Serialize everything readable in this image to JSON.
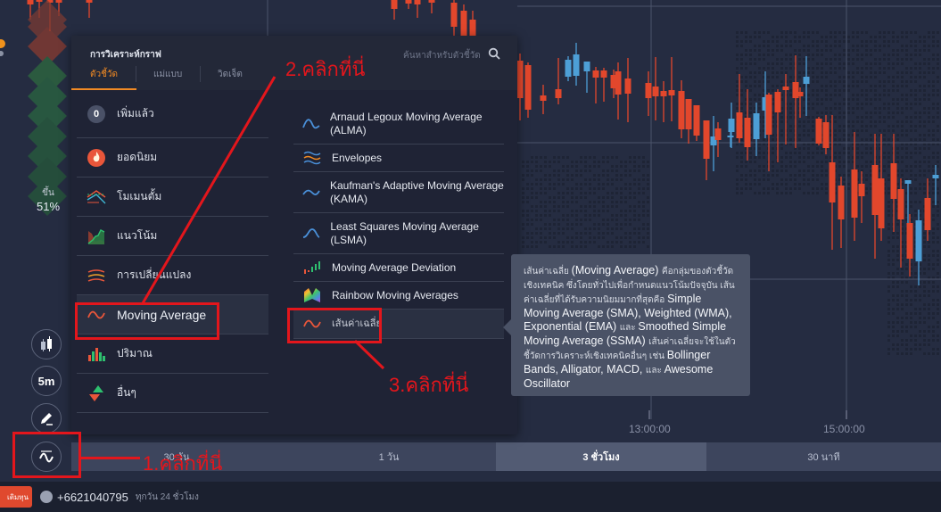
{
  "left_toolbar": {
    "sentiment_label": "ขึ้น",
    "sentiment_value": "51%",
    "chart_type_icon": "candlestick-icon",
    "timeframe_label": "5m",
    "draw_icon": "pencil-icon",
    "indicators_icon": "indicator-wave-icon"
  },
  "panel": {
    "title": "การวิเคราะห์กราฟ",
    "tabs": [
      {
        "label": "ตัวชี้วัด",
        "active": true
      },
      {
        "label": "แม่แบบ",
        "active": false
      },
      {
        "label": "วิดเจ็ต",
        "active": false
      }
    ],
    "search_placeholder": "ค้นหาสำหรับตัวชี้วัด",
    "categories": [
      {
        "label": "เพิ่มแล้ว",
        "badge": "0",
        "icon": "added-count-badge"
      },
      {
        "label": "ยอดนิยม",
        "icon": "fire-icon"
      },
      {
        "label": "โมเมนตั้ม",
        "icon": "momentum-icon"
      },
      {
        "label": "แนวโน้ม",
        "icon": "trend-icon"
      },
      {
        "label": "การเปลี่ยนแปลง",
        "icon": "volatility-icon"
      },
      {
        "label": "Moving Average",
        "icon": "moving-average-icon",
        "active": true
      },
      {
        "label": "ปริมาณ",
        "icon": "volume-icon"
      },
      {
        "label": "อื่นๆ",
        "icon": "other-arrows-icon"
      }
    ],
    "indicators": [
      {
        "label": "Arnaud Legoux Moving Average (ALMA)",
        "icon": "alma-icon"
      },
      {
        "label": "Envelopes",
        "icon": "envelopes-icon"
      },
      {
        "label": "Kaufman's Adaptive Moving Average (KAMA)",
        "icon": "kama-icon"
      },
      {
        "label": "Least Squares Moving Average (LSMA)",
        "icon": "lsma-icon"
      },
      {
        "label": "Moving Average Deviation",
        "icon": "ma-deviation-icon"
      },
      {
        "label": "Rainbow Moving Averages",
        "icon": "rainbow-icon"
      },
      {
        "label": "เส้นค่าเฉลี่ย",
        "icon": "moving-average-icon",
        "active": true
      }
    ]
  },
  "tooltip": {
    "parts": [
      {
        "t": "th",
        "v": "เส้นค่าเฉลี่ย "
      },
      {
        "t": "en",
        "v": "(Moving Average) "
      },
      {
        "t": "th",
        "v": "คือกลุ่มของตัวชี้วัดเชิงเทคนิค ซึ่งโดยทั่วไปเพื่อกำหนดแนวโน้มปัจจุบัน เส้นค่าเฉลี่ยที่ได้รับความนิยมมากที่สุดคือ "
      },
      {
        "t": "en",
        "v": "Simple Moving Average (SMA), Weighted (WMA), Exponential (EMA) "
      },
      {
        "t": "th",
        "v": "และ "
      },
      {
        "t": "en",
        "v": "Smoothed Simple Moving Average (SSMA) "
      },
      {
        "t": "th",
        "v": "เส้นค่าเฉลี่ยจะใช้ในตัวชี้วัดการวิเคราะห์เชิงเทคนิคอื่นๆ เช่น "
      },
      {
        "t": "en",
        "v": "Bollinger Bands, Alligator, MACD, "
      },
      {
        "t": "th",
        "v": "และ "
      },
      {
        "t": "en",
        "v": "Awesome Oscillator"
      }
    ]
  },
  "chart": {
    "time_labels": [
      "13:00:00",
      "15:00:00"
    ],
    "up_color": "#4d9fd6",
    "down_color": "#e2472c"
  },
  "range_bar": {
    "items": [
      {
        "label": "30 วัน",
        "active": false
      },
      {
        "label": "1 วัน",
        "active": false
      },
      {
        "label": "3 ชั่วโมง",
        "active": true
      },
      {
        "label": "30 นาที",
        "active": false
      }
    ]
  },
  "footer": {
    "deposit_label": "เติมทุน",
    "phone": "+6621040795",
    "hours": "ทุกวัน 24 ชั่วโมง"
  },
  "annotations": {
    "step1": "1.คลิกที่นี่",
    "step2": "2.คลิกที่นี่",
    "step3": "3.คลิกที่นี่"
  }
}
